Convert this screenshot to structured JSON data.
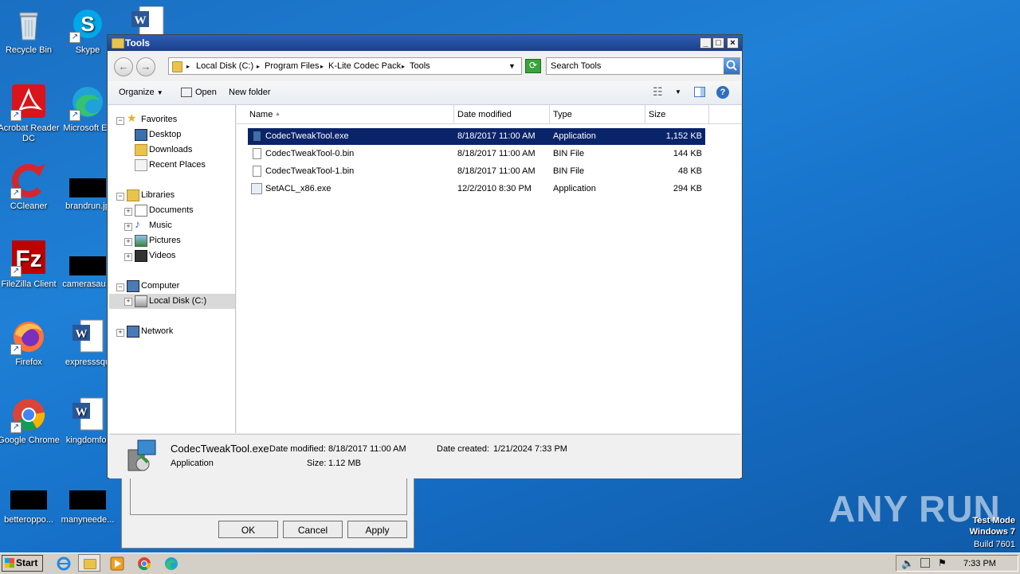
{
  "desktop": {
    "icons": [
      {
        "label": "Recycle Bin"
      },
      {
        "label": "Skype"
      },
      {
        "label": "Acrobat Reader DC"
      },
      {
        "label": "Microsoft Ed"
      },
      {
        "label": "CCleaner"
      },
      {
        "label": "brandrun.jp"
      },
      {
        "label": "FileZilla Client"
      },
      {
        "label": "camerasau..."
      },
      {
        "label": "Firefox"
      },
      {
        "label": "expresssqu"
      },
      {
        "label": "Google Chrome"
      },
      {
        "label": "kingdomfor"
      },
      {
        "label": "betteroppo..."
      },
      {
        "label": "manyneede..."
      }
    ]
  },
  "background_dialog": {
    "ok_label": "OK",
    "cancel_label": "Cancel",
    "apply_label": "Apply"
  },
  "window": {
    "title": "Tools",
    "caption_min": "_",
    "caption_max": "□",
    "caption_close": "×",
    "breadcrumbs": [
      "Local Disk (C:)",
      "Program Files",
      "K-Lite Codec Pack",
      "Tools"
    ],
    "search_placeholder": "Search Tools",
    "toolbar": {
      "organize_label": "Organize",
      "open_label": "Open",
      "new_folder_label": "New folder"
    },
    "nav": {
      "favorites": "Favorites",
      "desktop": "Desktop",
      "downloads": "Downloads",
      "recent_places": "Recent Places",
      "libraries": "Libraries",
      "documents": "Documents",
      "music": "Music",
      "pictures": "Pictures",
      "videos": "Videos",
      "computer": "Computer",
      "local_disk": "Local Disk (C:)",
      "network": "Network"
    },
    "columns": {
      "name": "Name",
      "date": "Date modified",
      "type": "Type",
      "size": "Size"
    },
    "files": [
      {
        "name": "CodecTweakTool.exe",
        "date": "8/18/2017 11:00 AM",
        "type": "Application",
        "size": "1,152 KB"
      },
      {
        "name": "CodecTweakTool-0.bin",
        "date": "8/18/2017 11:00 AM",
        "type": "BIN File",
        "size": "144 KB"
      },
      {
        "name": "CodecTweakTool-1.bin",
        "date": "8/18/2017 11:00 AM",
        "type": "BIN File",
        "size": "48 KB"
      },
      {
        "name": "SetACL_x86.exe",
        "date": "12/2/2010 8:30 PM",
        "type": "Application",
        "size": "294 KB"
      }
    ],
    "details": {
      "filename": "CodecTweakTool.exe",
      "type": "Application",
      "modified_label": "Date modified:",
      "modified_value": "8/18/2017 11:00 AM",
      "created_label": "Date created:",
      "created_value": "1/21/2024 7:33 PM",
      "size_label": "Size:",
      "size_value": "1.12 MB"
    }
  },
  "taskbar": {
    "start_label": "Start",
    "clock": "7:33 PM"
  },
  "watermark": {
    "brand": "ANY RUN",
    "line1": "Test Mode",
    "line2": "Windows 7",
    "line3": "Build 7601"
  },
  "colors": {
    "desktop_bg": "#1e80d6",
    "selection": "#0a246a",
    "titlebar": "#2d5fb5"
  }
}
